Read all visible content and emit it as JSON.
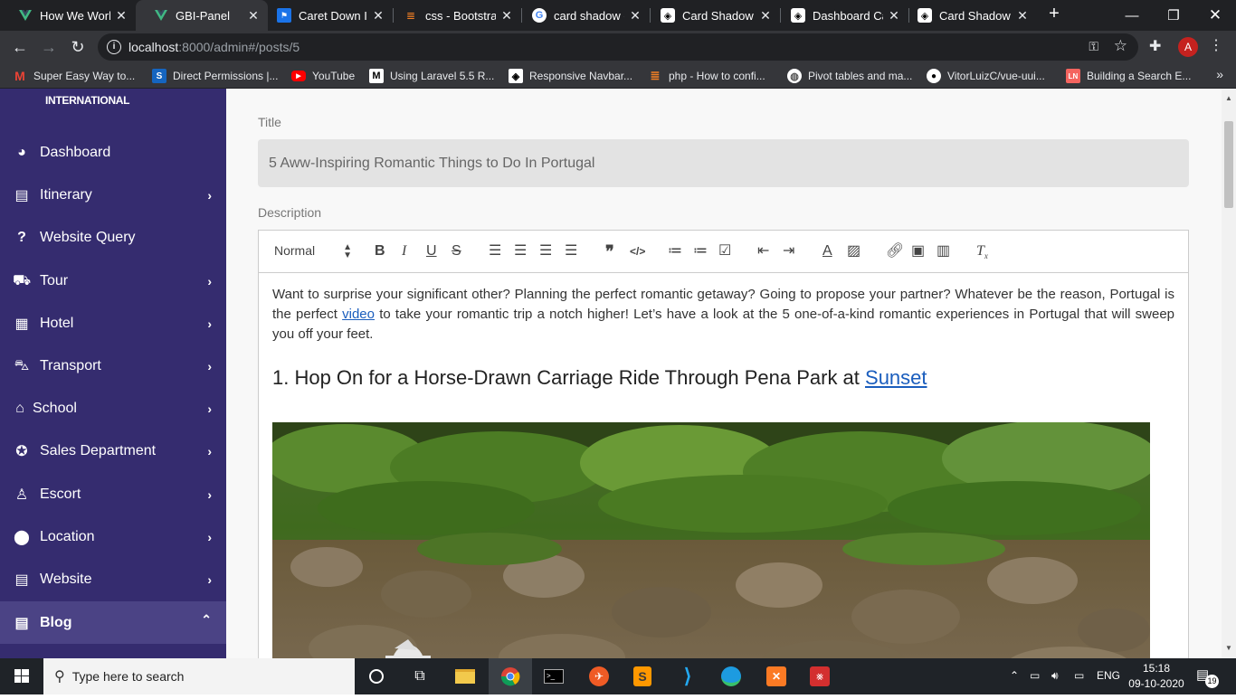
{
  "browser": {
    "tabs": [
      {
        "label": "How We Work",
        "icon": "vue-icon",
        "active": false
      },
      {
        "label": "GBI-Panel",
        "icon": "vue-icon",
        "active": true
      },
      {
        "label": "Caret Down Ic",
        "icon": "flag-icon",
        "active": false
      },
      {
        "label": "css - Bootstrap",
        "icon": "stackoverflow-icon",
        "active": false
      },
      {
        "label": "card shadow c",
        "icon": "google-icon",
        "active": false
      },
      {
        "label": "Card Shadow",
        "icon": "codepen-icon",
        "active": false
      },
      {
        "label": "Dashboard Ca",
        "icon": "codepen-icon",
        "active": false
      },
      {
        "label": "Card Shadow c",
        "icon": "codepen-icon",
        "active": false
      }
    ],
    "url_host": "localhost",
    "url_path": ":8000/admin#/posts/5",
    "profile_initial": "A",
    "bookmarks": [
      {
        "label": "Super Easy Way to...",
        "icon": "gmail-icon"
      },
      {
        "label": "Direct Permissions |...",
        "icon": "s-icon"
      },
      {
        "label": "YouTube",
        "icon": "youtube-icon"
      },
      {
        "label": "Using Laravel 5.5 R...",
        "icon": "medium-icon"
      },
      {
        "label": "Responsive Navbar...",
        "icon": "codepen-icon"
      },
      {
        "label": "php - How to confi...",
        "icon": "stackoverflow-icon"
      },
      {
        "label": "Pivot tables and ma...",
        "icon": "globe-icon"
      },
      {
        "label": "VitorLuizC/vue-uui...",
        "icon": "github-icon"
      },
      {
        "label": "Building a Search E...",
        "icon": "laravel-news-icon"
      }
    ]
  },
  "sidebar": {
    "brand": "INTERNATIONAL",
    "items": [
      {
        "label": "Dashboard",
        "icon": "dashboard-icon",
        "chevron": ""
      },
      {
        "label": "Itinerary",
        "icon": "document-icon",
        "chevron": "›"
      },
      {
        "label": "Website Query",
        "icon": "question-icon",
        "chevron": ""
      },
      {
        "label": "Tour",
        "icon": "bus-icon",
        "chevron": "›"
      },
      {
        "label": "Hotel",
        "icon": "building-icon",
        "chevron": "›"
      },
      {
        "label": "Transport",
        "icon": "car-icon",
        "chevron": "›"
      },
      {
        "label": "School",
        "icon": "school-icon",
        "chevron": "›"
      },
      {
        "label": "Sales Department",
        "icon": "sales-icon",
        "chevron": "›"
      },
      {
        "label": "Escort",
        "icon": "person-icon",
        "chevron": "›"
      },
      {
        "label": "Location",
        "icon": "map-pin-icon",
        "chevron": "›"
      },
      {
        "label": "Website",
        "icon": "document-icon",
        "chevron": "›"
      },
      {
        "label": "Blog",
        "icon": "document-icon",
        "chevron": "⌃"
      }
    ]
  },
  "form": {
    "title_label": "Title",
    "title_value": "5 Aww-Inspiring Romantic Things to Do In Portugal",
    "description_label": "Description",
    "format_select": "Normal"
  },
  "content": {
    "para_before_link": "Want to surprise your significant other? Planning the perfect romantic getaway? Going to propose your partner? Whatever be the reason, Portugal is the perfect ",
    "para_link": "video",
    "para_after_link": " to take your romantic trip a notch higher! Let’s have a look at the 5 one-of-a-kind romantic experiences in Portugal that will sweep you off your feet.",
    "heading_text": "1. Hop On for a Horse-Drawn Carriage Ride Through Pena Park at ",
    "heading_link": "Sunset"
  },
  "taskbar": {
    "search_placeholder": "Type here to search",
    "language": "ENG",
    "time": "15:18",
    "date": "09-10-2020",
    "notification_count": "19"
  },
  "colors": {
    "sidebar_bg": "#352c6f",
    "sidebar_active": "#4b4385",
    "link": "#1a5dbd"
  }
}
